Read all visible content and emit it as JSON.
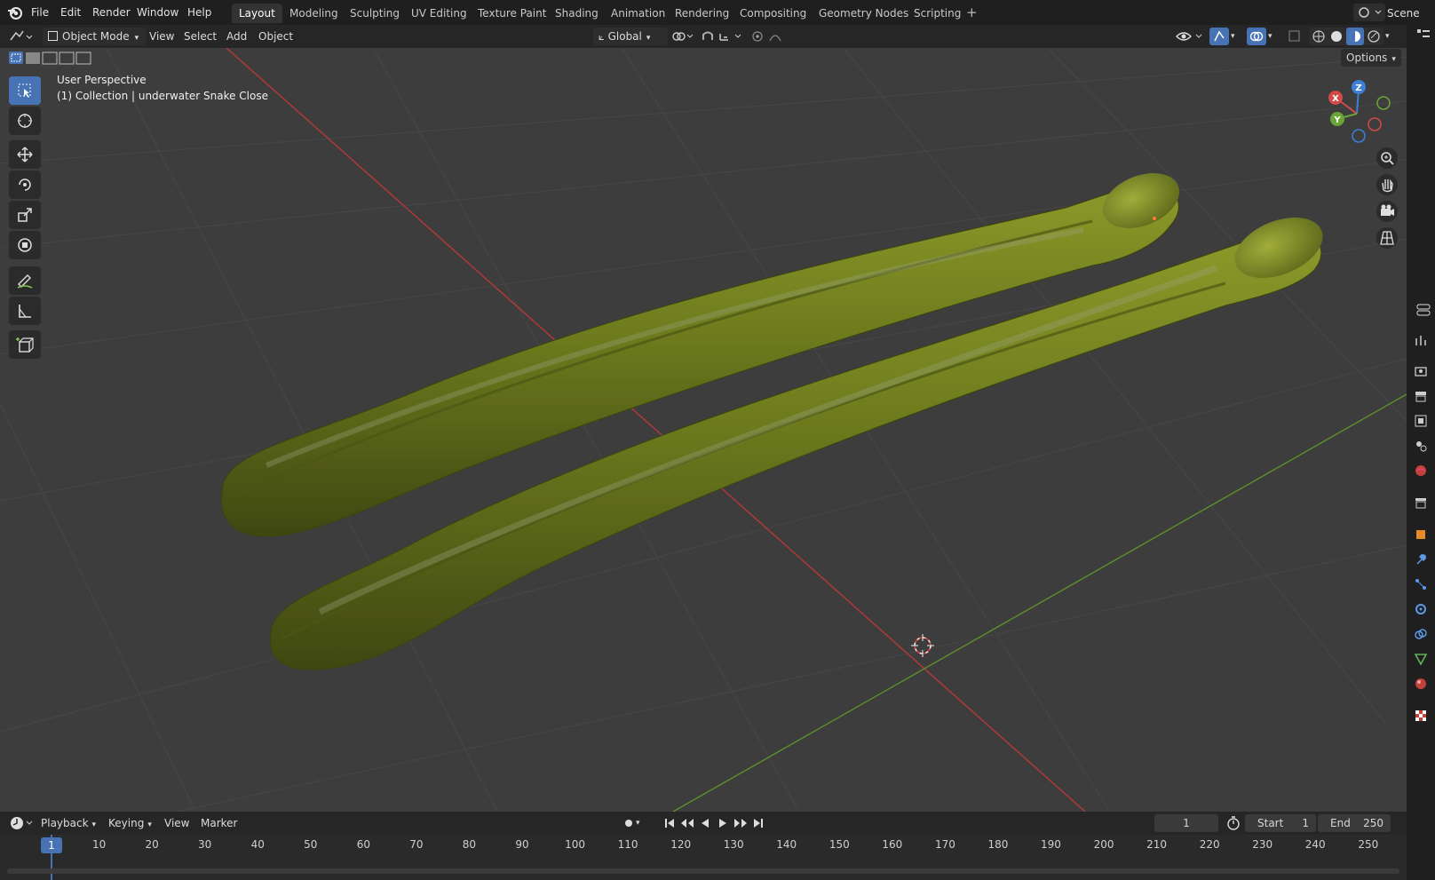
{
  "menu": [
    "File",
    "Edit",
    "Render",
    "Window",
    "Help"
  ],
  "workspaces": [
    "Layout",
    "Modeling",
    "Sculpting",
    "UV Editing",
    "Texture Paint",
    "Shading",
    "Animation",
    "Rendering",
    "Compositing",
    "Geometry Nodes",
    "Scripting"
  ],
  "active_workspace": "Layout",
  "scene_name": "Scene",
  "viewport_header": {
    "mode": "Object Mode",
    "menus": [
      "View",
      "Select",
      "Add",
      "Object"
    ],
    "orientation": "Global",
    "options_label": "Options"
  },
  "overlay_text": {
    "perspective": "User Perspective",
    "collection": "(1) Collection | underwater Snake Close"
  },
  "gizmo": {
    "x": "X",
    "y": "Y",
    "z": "Z"
  },
  "timeline": {
    "menus": [
      "Playback",
      "Keying",
      "View",
      "Marker"
    ],
    "current_frame": "1",
    "start_label": "Start",
    "start_value": "1",
    "end_label": "End",
    "end_value": "250",
    "ruler": [
      "1",
      "10",
      "20",
      "30",
      "40",
      "50",
      "60",
      "70",
      "80",
      "90",
      "100",
      "110",
      "120",
      "130",
      "140",
      "150",
      "160",
      "170",
      "180",
      "190",
      "200",
      "210",
      "220",
      "230",
      "240",
      "250"
    ]
  },
  "colors": {
    "accent": "#4772b3",
    "x_axis": "#d34a4a",
    "y_axis": "#6aa637",
    "z_axis": "#3f7fd8",
    "snake": "#6b7a1d"
  }
}
